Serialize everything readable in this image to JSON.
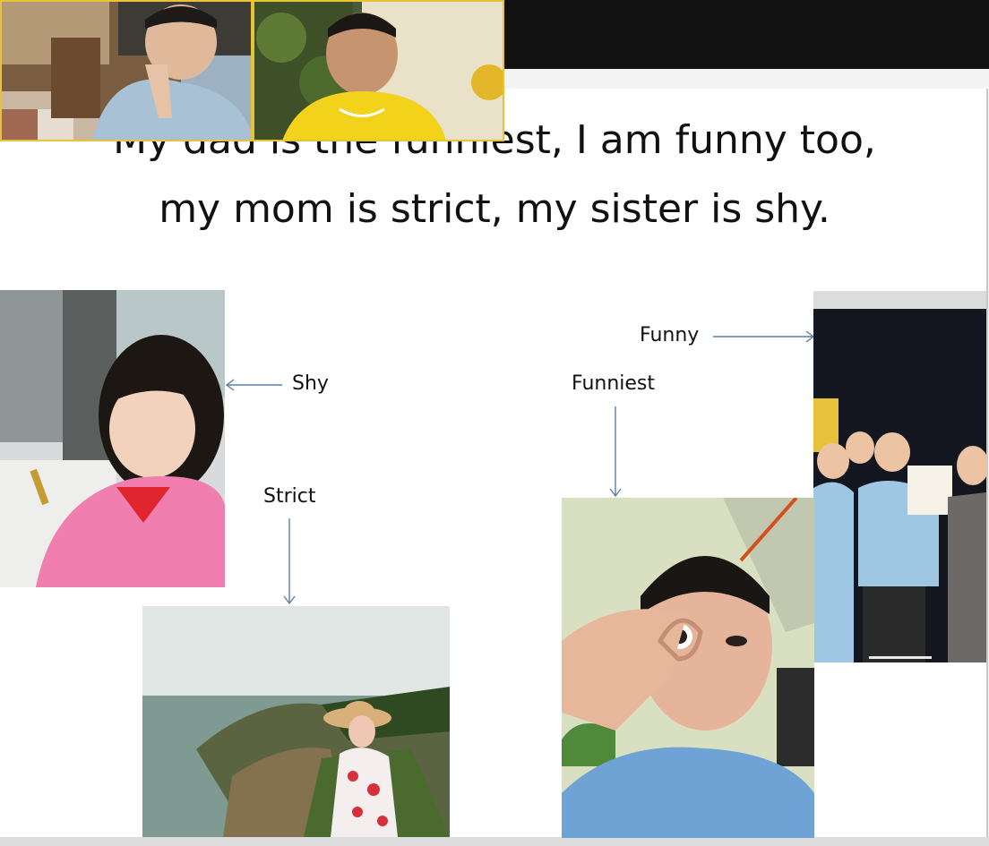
{
  "slide": {
    "title_line_1": "My dad is the funniest, I am funny too,",
    "title_line_2": "my mom is strict, my sister is shy."
  },
  "labels": {
    "shy": "Shy",
    "strict": "Strict",
    "funniest": "Funniest",
    "funny": "Funny"
  },
  "colors": {
    "arrow": "#5b7fa8",
    "active_speaker_border": "#e9c23a",
    "slide_background": "#ffffff"
  },
  "photos": {
    "sister": "photo of girl writing (sister)",
    "mom": "photo of woman at seaside cliff (mom)",
    "dad": "photo of man making funny face (dad)",
    "kids": "photo of boys with certificate (funny)"
  }
}
